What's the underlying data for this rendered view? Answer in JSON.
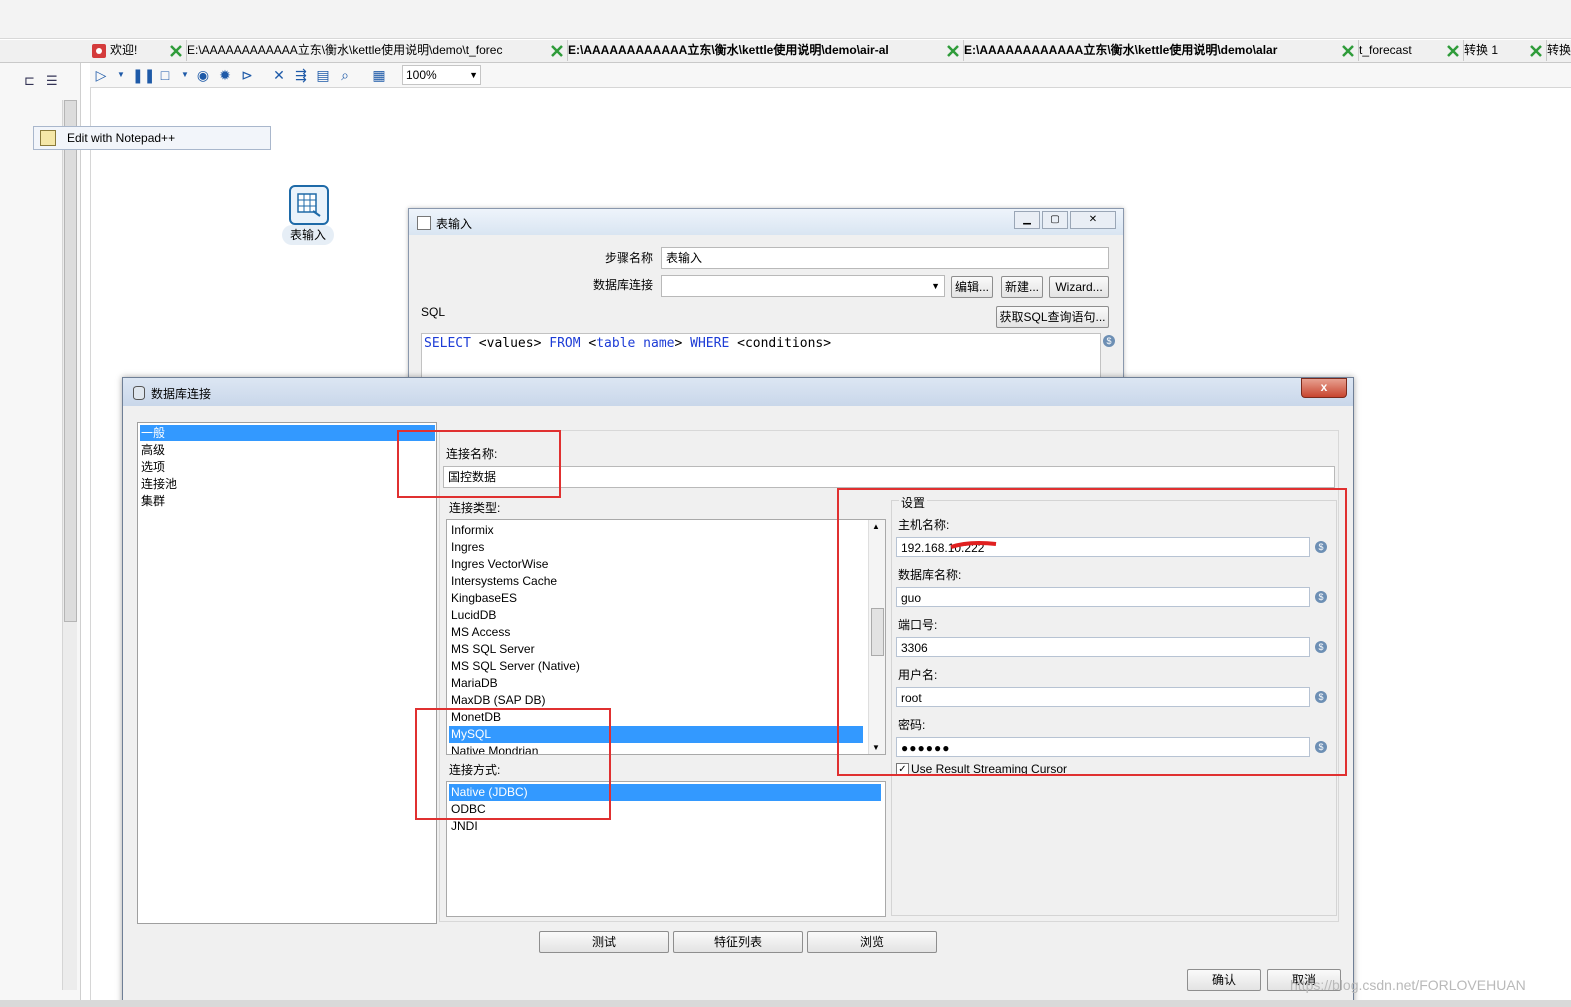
{
  "tabs": [
    {
      "label": "欢迎!",
      "bold": false
    },
    {
      "label": "E:\\AAAAAAAAAAAA立东\\衡水\\kettle使用说明\\demo\\t_forec",
      "bold": false
    },
    {
      "label": "E:\\AAAAAAAAAAAA立东\\衡水\\kettle使用说明\\demo\\air-al",
      "bold": true
    },
    {
      "label": "E:\\AAAAAAAAAAAA立东\\衡水\\kettle使用说明\\demo\\alar",
      "bold": true
    },
    {
      "label": "t_forecast",
      "bold": false
    },
    {
      "label": "转换 1",
      "bold": false
    },
    {
      "label": "转换",
      "bold": false
    }
  ],
  "toolbar": {
    "zoom": "100%"
  },
  "context_menu": {
    "item": "Edit with Notepad++"
  },
  "canvas": {
    "step_label": "表输入"
  },
  "table_input": {
    "title": "表输入",
    "step_name_label": "步骤名称",
    "step_name_value": "表输入",
    "db_conn_label": "数据库连接",
    "btn_edit": "编辑...",
    "btn_new": "新建...",
    "btn_wizard": "Wizard...",
    "sql_label": "SQL",
    "btn_get_sql": "获取SQL查询语句...",
    "sql_tokens": [
      "SELECT",
      " <values> ",
      "FROM",
      " <",
      "table name",
      "> ",
      "WHERE",
      " <conditions>"
    ]
  },
  "db_dialog": {
    "title": "数据库连接",
    "close_label": "x",
    "nav": [
      "一般",
      "高级",
      "选项",
      "连接池",
      "集群"
    ],
    "conn_name_label": "连接名称:",
    "conn_name_value": "国控数据",
    "conn_type_label": "连接类型:",
    "conn_types": [
      "Informix",
      "Ingres",
      "Ingres VectorWise",
      "Intersystems Cache",
      "KingbaseES",
      "LucidDB",
      "MS Access",
      "MS SQL Server",
      "MS SQL Server (Native)",
      "MariaDB",
      "MaxDB (SAP DB)",
      "MonetDB",
      "MySQL",
      "Native Mondrian"
    ],
    "conn_type_selected": "MySQL",
    "access_label": "连接方式:",
    "access_methods": [
      "Native (JDBC)",
      "ODBC",
      "JNDI"
    ],
    "access_selected": "Native (JDBC)",
    "settings_label": "设置",
    "host_label": "主机名称:",
    "host_value": "192.168.10.222",
    "dbname_label": "数据库名称:",
    "dbname_value": "guo",
    "port_label": "端口号:",
    "port_value": "3306",
    "user_label": "用户名:",
    "user_value": "root",
    "password_label": "密码:",
    "password_value": "●●●●●●",
    "streaming_label": "Use Result Streaming Cursor",
    "streaming_checked": "✓",
    "btn_test": "测试",
    "btn_features": "特征列表",
    "btn_browse": "浏览",
    "btn_ok": "确认",
    "btn_cancel": "取消"
  },
  "watermark": "https://blog.csdn.net/FORLOVEHUAN"
}
